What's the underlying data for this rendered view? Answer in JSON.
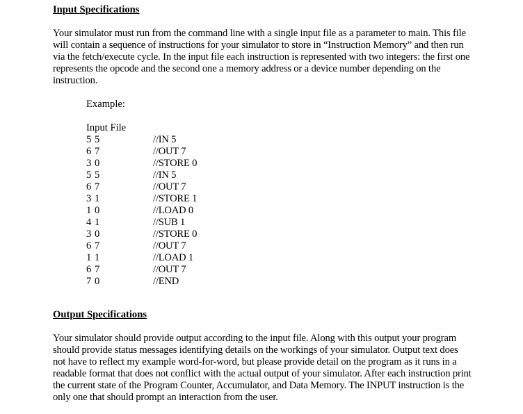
{
  "input_section": {
    "heading": "Input Specifications",
    "paragraph_lines": [
      "Your simulator must run from the command line with a single input file as a parameter to main. This file",
      "will contain a sequence of instructions for your simulator to store in “Instruction Memory” and then run",
      "via the fetch/execute cycle. In the input file each instruction is represented with two integers: the first one",
      "represents the opcode and the second one a memory address or a device number depending on the",
      "instruction."
    ],
    "example_label": "Example:",
    "input_file_label": "Input File",
    "instructions": [
      {
        "code": "5 5",
        "comment": "//IN 5"
      },
      {
        "code": "6 7",
        "comment": "//OUT 7"
      },
      {
        "code": "3 0",
        "comment": "//STORE 0"
      },
      {
        "code": "5 5",
        "comment": "//IN 5"
      },
      {
        "code": "6 7",
        "comment": "//OUT 7"
      },
      {
        "code": "3 1",
        "comment": "//STORE 1"
      },
      {
        "code": "1 0",
        "comment": "//LOAD 0"
      },
      {
        "code": "4 1",
        "comment": "//SUB 1"
      },
      {
        "code": "3 0",
        "comment": "//STORE 0"
      },
      {
        "code": "6 7",
        "comment": "//OUT 7"
      },
      {
        "code": "1 1",
        "comment": "//LOAD 1"
      },
      {
        "code": "6 7",
        "comment": "//OUT 7"
      },
      {
        "code": "7 0",
        "comment": "//END"
      }
    ]
  },
  "output_section": {
    "heading": "Output Specifications",
    "paragraph_lines": [
      "Your simulator should provide output according to the input file. Along with this output your program",
      "should provide status messages identifying details on the workings of your simulator. Output text does",
      "not have to reflect my example word-for-word, but please provide detail on the program as it runs in a",
      "readable format that does not conflict with the actual output of your simulator. After each instruction print",
      "the current state of the Program Counter, Accumulator, and Data Memory. The INPUT instruction is the",
      "only one that should prompt an interaction from the user."
    ]
  }
}
